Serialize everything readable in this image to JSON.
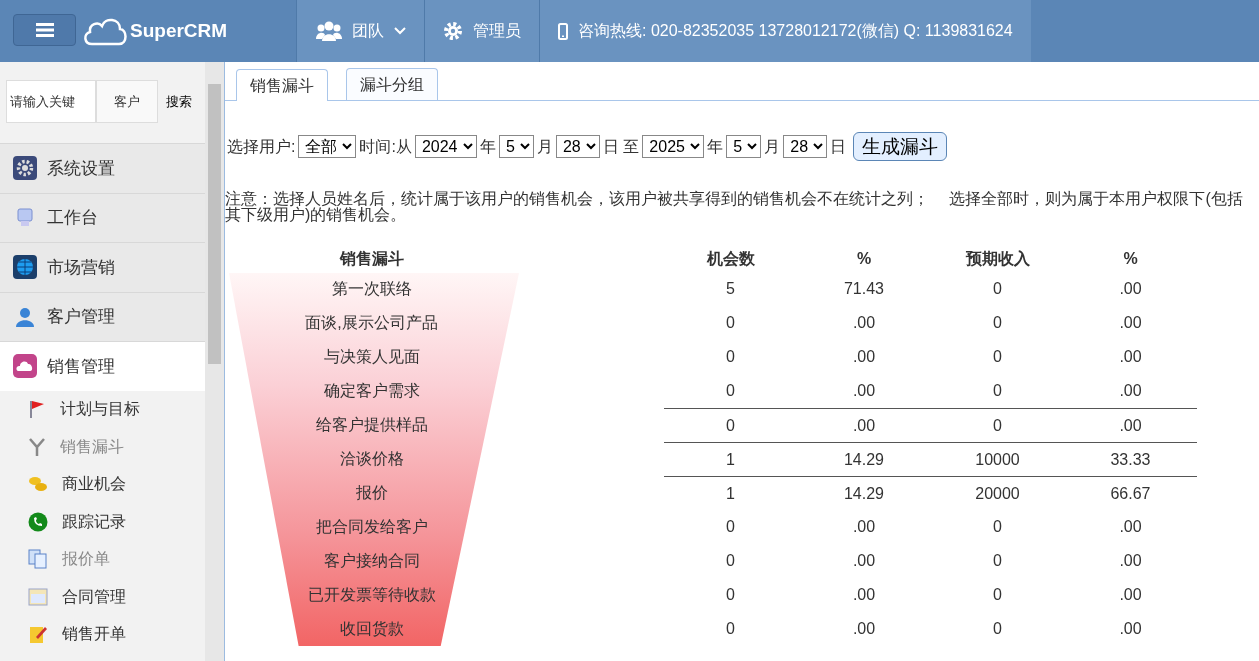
{
  "header": {
    "brand": "SuperCRM",
    "nav": [
      {
        "label": "团队",
        "dropdown": true
      },
      {
        "label": "管理员",
        "dropdown": false
      },
      {
        "label": "咨询热线: 020-82352035 13728012172(微信) Q: 1139831624",
        "dropdown": false
      }
    ]
  },
  "sidebar": {
    "search": {
      "placeholder": "请输入关键",
      "scope": "客户",
      "button": "搜索"
    },
    "menu": [
      {
        "label": "系统设置",
        "selected": false
      },
      {
        "label": "工作台",
        "selected": false
      },
      {
        "label": "市场营销",
        "selected": false
      },
      {
        "label": "客户管理",
        "selected": false
      },
      {
        "label": "销售管理",
        "selected": true,
        "children": [
          {
            "label": "计划与目标",
            "dimmed": false
          },
          {
            "label": "销售漏斗",
            "dimmed": true
          },
          {
            "label": "商业机会",
            "dimmed": false
          },
          {
            "label": "跟踪记录",
            "dimmed": false
          },
          {
            "label": "报价单",
            "dimmed": true
          },
          {
            "label": "合同管理",
            "dimmed": false
          },
          {
            "label": "销售开单",
            "dimmed": false
          }
        ]
      }
    ]
  },
  "tabs": [
    {
      "label": "销售漏斗",
      "selected": true
    },
    {
      "label": "漏斗分组",
      "selected": false
    }
  ],
  "filter": [
    {
      "kind": "text",
      "text": "选择用户:"
    },
    {
      "kind": "select",
      "value": "全部"
    },
    {
      "kind": "text",
      "text": "时间:从"
    },
    {
      "kind": "select",
      "value": "2024"
    },
    {
      "kind": "text",
      "text": "年"
    },
    {
      "kind": "select",
      "value": "5"
    },
    {
      "kind": "text",
      "text": "月"
    },
    {
      "kind": "select",
      "value": "28"
    },
    {
      "kind": "text",
      "text": "日 至"
    },
    {
      "kind": "select",
      "value": "2025"
    },
    {
      "kind": "text",
      "text": "年"
    },
    {
      "kind": "select",
      "value": "5"
    },
    {
      "kind": "text",
      "text": "月"
    },
    {
      "kind": "select",
      "value": "28"
    },
    {
      "kind": "text",
      "text": "日"
    },
    {
      "kind": "button",
      "text": "生成漏斗"
    }
  ],
  "note": "注意：选择人员姓名后，统计属于该用户的销售机会，该用户被共享得到的销售机会不在统计之列；　 选择全部时，则为属于本用户权限下(包括其下级用户)的销售机会。",
  "table": {
    "columns": [
      "销售漏斗",
      "机会数",
      "%",
      "预期收入",
      "%"
    ],
    "rows": [
      {
        "stage": "第一次联络",
        "count": "5",
        "count_pct": "71.43",
        "revenue": "0",
        "revenue_pct": ".00",
        "rule_above": false
      },
      {
        "stage": "面谈,展示公司产品",
        "count": "0",
        "count_pct": ".00",
        "revenue": "0",
        "revenue_pct": ".00",
        "rule_above": false
      },
      {
        "stage": "与决策人见面",
        "count": "0",
        "count_pct": ".00",
        "revenue": "0",
        "revenue_pct": ".00",
        "rule_above": false
      },
      {
        "stage": "确定客户需求",
        "count": "0",
        "count_pct": ".00",
        "revenue": "0",
        "revenue_pct": ".00",
        "rule_above": false
      },
      {
        "stage": "给客户提供样品",
        "count": "0",
        "count_pct": ".00",
        "revenue": "0",
        "revenue_pct": ".00",
        "rule_above": true
      },
      {
        "stage": "洽谈价格",
        "count": "1",
        "count_pct": "14.29",
        "revenue": "10000",
        "revenue_pct": "33.33",
        "rule_above": true
      },
      {
        "stage": "报价",
        "count": "1",
        "count_pct": "14.29",
        "revenue": "20000",
        "revenue_pct": "66.67",
        "rule_above": true
      },
      {
        "stage": "把合同发给客户",
        "count": "0",
        "count_pct": ".00",
        "revenue": "0",
        "revenue_pct": ".00",
        "rule_above": false
      },
      {
        "stage": "客户接纳合同",
        "count": "0",
        "count_pct": ".00",
        "revenue": "0",
        "revenue_pct": ".00",
        "rule_above": false
      },
      {
        "stage": "已开发票等待收款",
        "count": "0",
        "count_pct": ".00",
        "revenue": "0",
        "revenue_pct": ".00",
        "rule_above": false
      },
      {
        "stage": "收回货款",
        "count": "0",
        "count_pct": ".00",
        "revenue": "0",
        "revenue_pct": ".00",
        "rule_above": false
      }
    ]
  }
}
